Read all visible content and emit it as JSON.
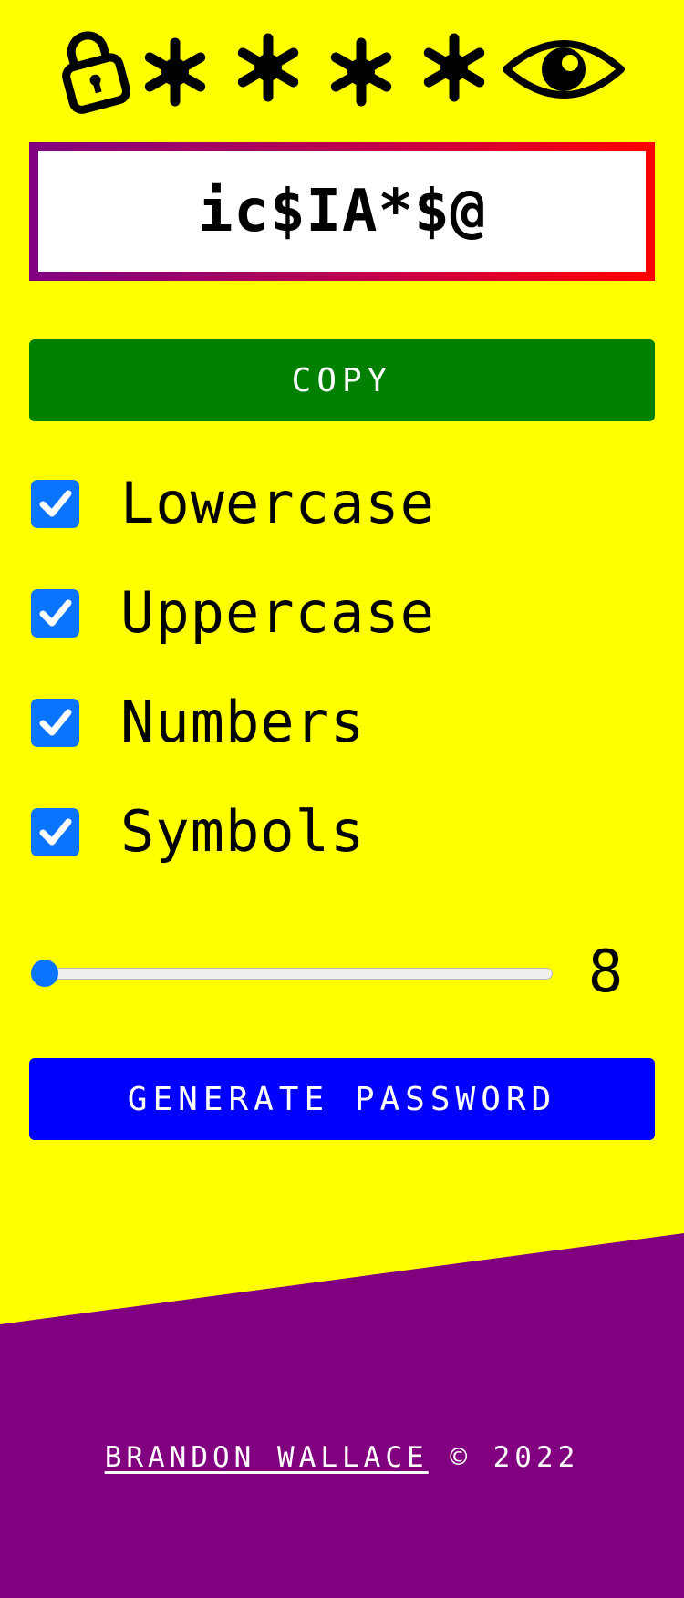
{
  "header": {
    "icons": [
      "lock-icon",
      "asterisk-icon",
      "asterisk-icon",
      "asterisk-icon",
      "asterisk-icon",
      "eye-icon"
    ]
  },
  "password": {
    "value": "ic$IA*$@"
  },
  "copy_button": {
    "label": "COPY"
  },
  "options": [
    {
      "label": "Lowercase",
      "checked": true
    },
    {
      "label": "Uppercase",
      "checked": true
    },
    {
      "label": "Numbers",
      "checked": true
    },
    {
      "label": "Symbols",
      "checked": true
    }
  ],
  "length": {
    "value": "8",
    "slider_fraction": 0
  },
  "generate_button": {
    "label": "GENERATE PASSWORD"
  },
  "footer": {
    "author": "BRANDON WALLACE",
    "copyright": " © 2022"
  },
  "colors": {
    "background": "#ffff00",
    "footer": "#800080",
    "copy_button": "#008000",
    "generate_button": "#0000ff",
    "checkbox": "#0a74ff",
    "password_border_start": "#800080",
    "password_border_end": "#ff0000"
  }
}
